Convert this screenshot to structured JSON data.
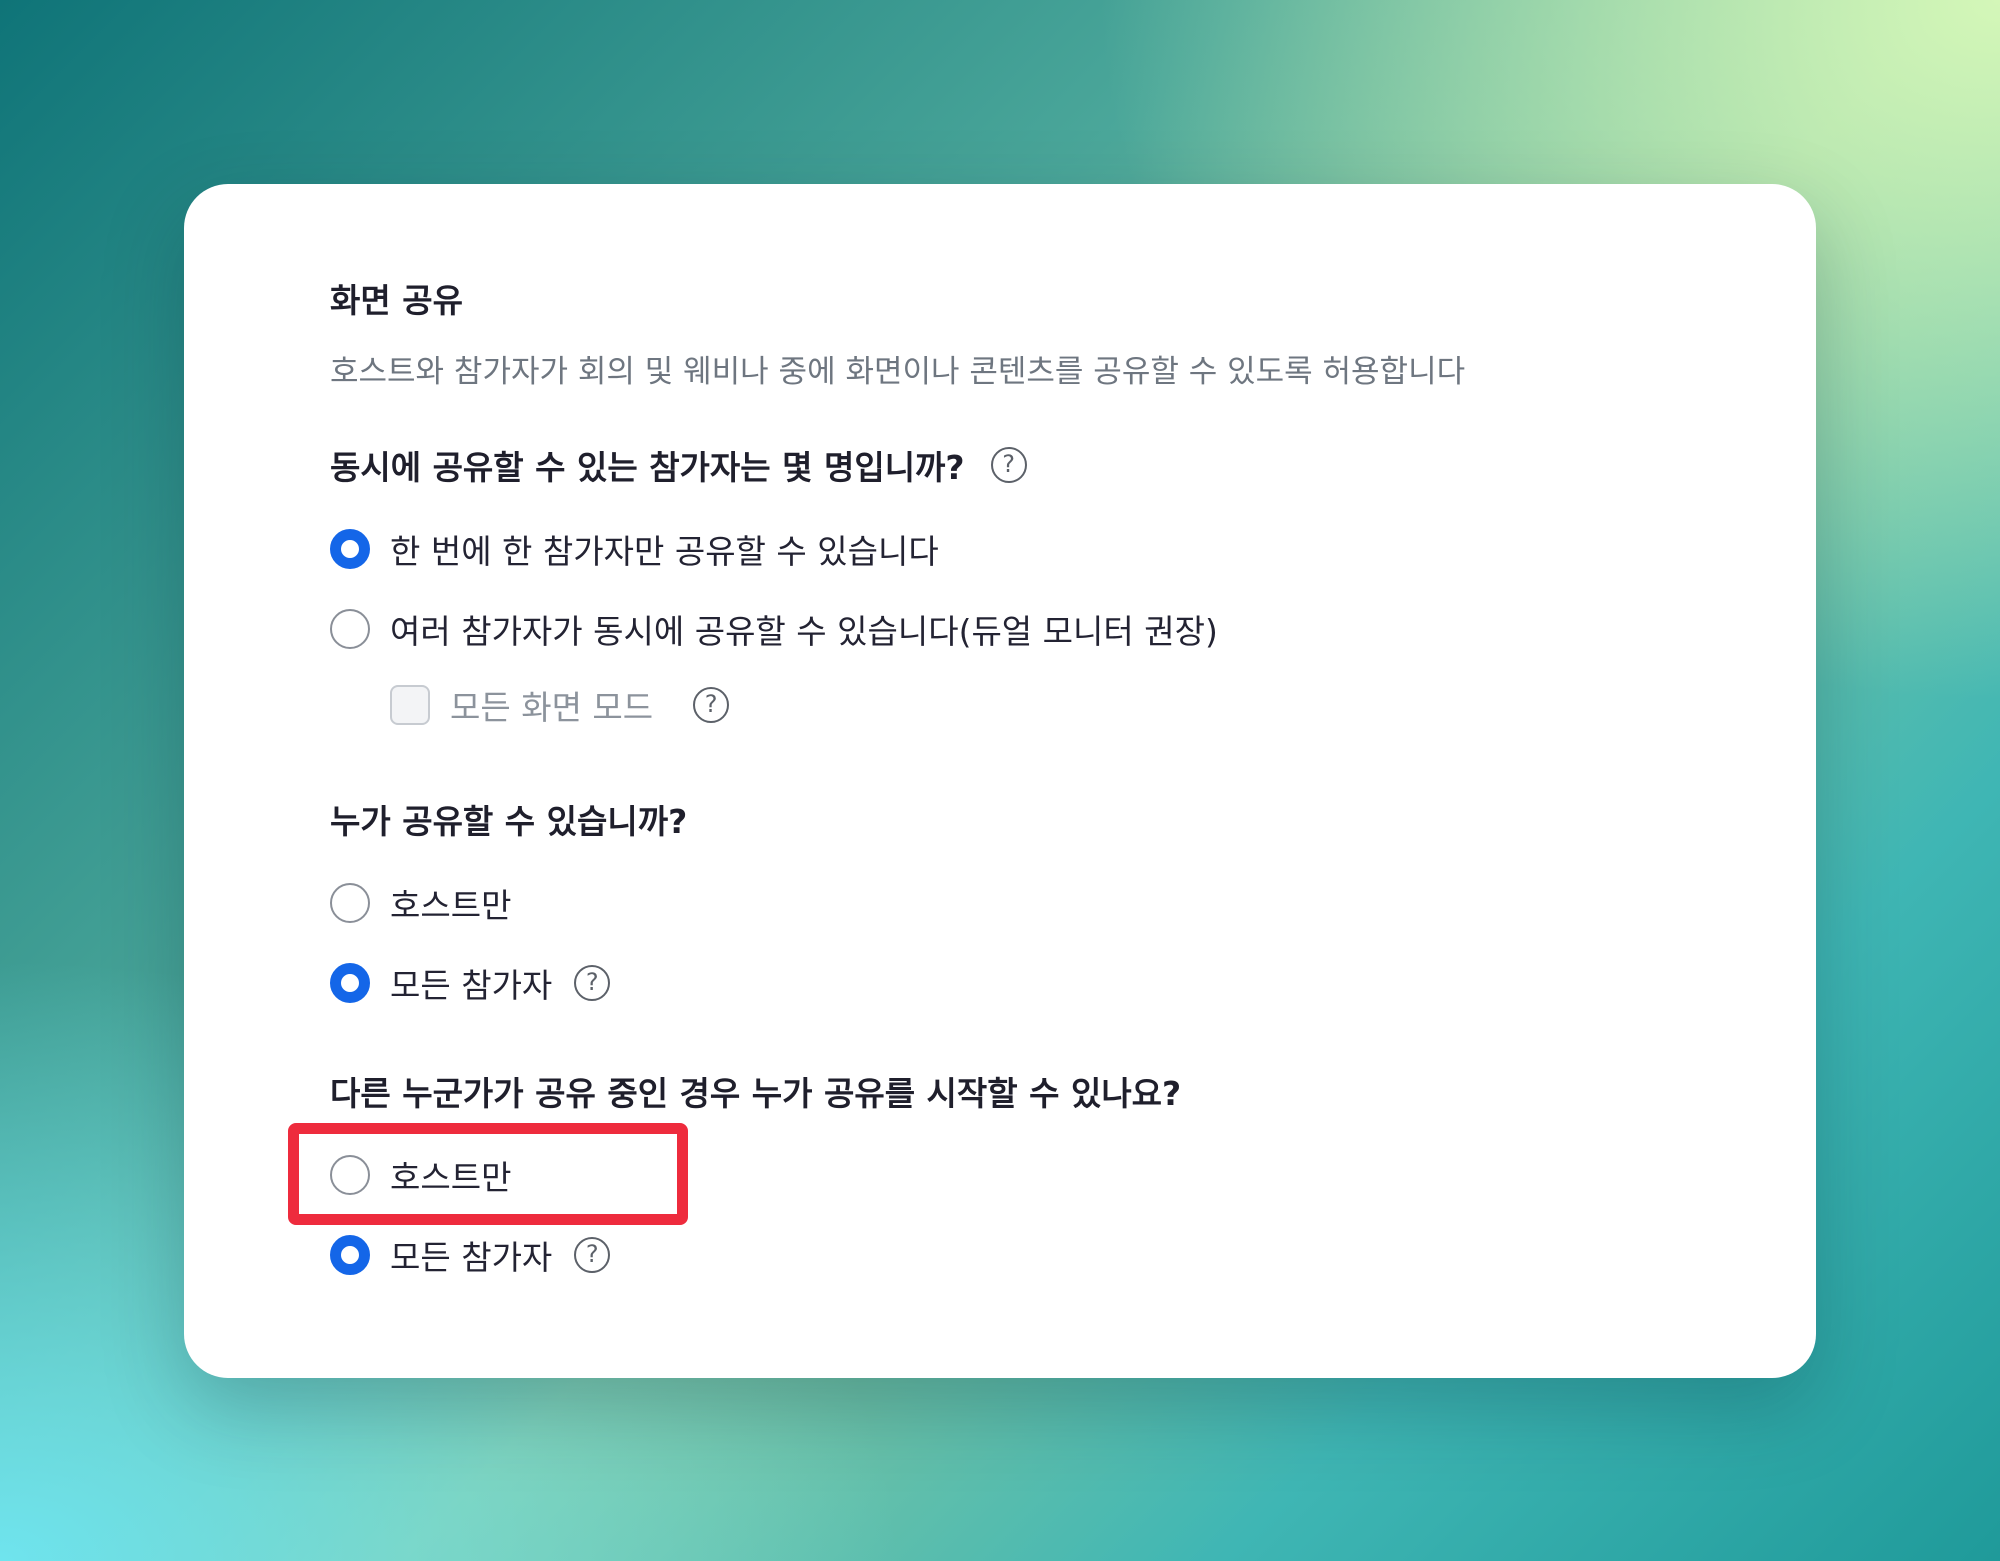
{
  "card": {
    "title": "화면 공유",
    "description": "호스트와 참가자가 회의 및 웨비나 중에 화면이나 콘텐츠를 공유할 수 있도록 허용합니다"
  },
  "sections": [
    {
      "question": "동시에 공유할 수 있는 참가자는 몇 명입니까?",
      "help_icon": "?",
      "options": [
        {
          "label": "한 번에 한 참가자만 공유할 수 있습니다",
          "checked": true
        },
        {
          "label": "여러 참가자가 동시에 공유할 수 있습니다(듀얼 모니터 권장)",
          "checked": false
        }
      ],
      "sub_option": {
        "label": "모든 화면 모드",
        "checked": false,
        "disabled": true,
        "help_icon": "?"
      }
    },
    {
      "question": "누가 공유할 수 있습니까?",
      "options": [
        {
          "label": "호스트만",
          "checked": false
        },
        {
          "label": "모든 참가자",
          "checked": true,
          "help_icon": "?"
        }
      ]
    },
    {
      "question": "다른 누군가가 공유 중인 경우 누가 공유를 시작할 수 있나요?",
      "options": [
        {
          "label": "호스트만",
          "checked": false,
          "highlighted": true
        },
        {
          "label": "모든 참가자",
          "checked": true,
          "help_icon": "?"
        }
      ]
    }
  ],
  "colors": {
    "accent": "#1466e8",
    "highlight": "#ee2b3d"
  }
}
